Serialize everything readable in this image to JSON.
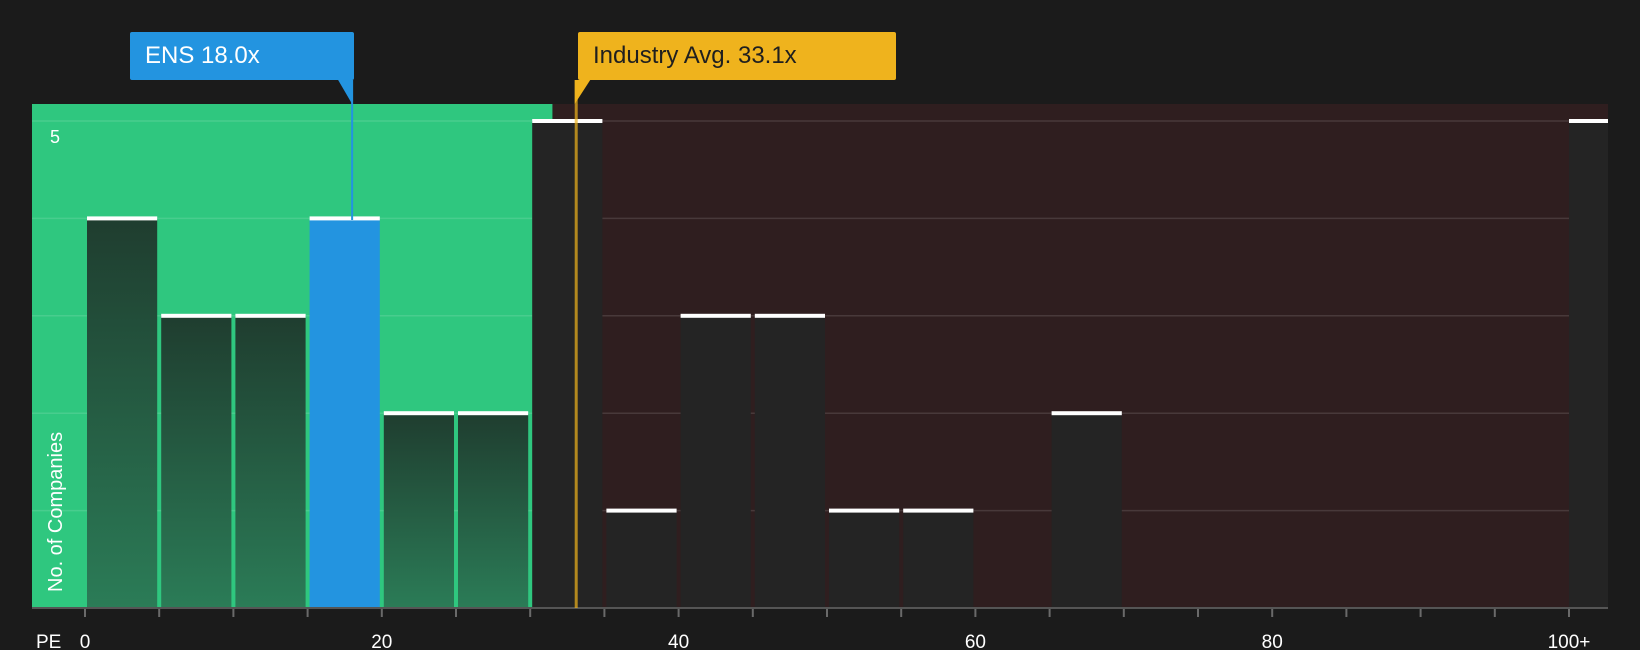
{
  "chart_data": {
    "type": "bar",
    "xlabel": "PE",
    "ylabel": "No. of Companies",
    "x_ticks": [
      "0",
      "20",
      "40",
      "60",
      "80",
      "100+"
    ],
    "y_ticks": [
      "5"
    ],
    "bin_width": 5,
    "xlim": [
      0,
      100
    ],
    "ylim": [
      0,
      5
    ],
    "bins": [
      {
        "x": 0,
        "value": 4
      },
      {
        "x": 5,
        "value": 3
      },
      {
        "x": 10,
        "value": 3
      },
      {
        "x": 15,
        "value": 4
      },
      {
        "x": 20,
        "value": 2
      },
      {
        "x": 25,
        "value": 2
      },
      {
        "x": 30,
        "value": 5
      },
      {
        "x": 35,
        "value": 1
      },
      {
        "x": 40,
        "value": 3
      },
      {
        "x": 45,
        "value": 3
      },
      {
        "x": 50,
        "value": 1
      },
      {
        "x": 55,
        "value": 1
      },
      {
        "x": 60,
        "value": 0
      },
      {
        "x": 65,
        "value": 2
      },
      {
        "x": 70,
        "value": 0
      },
      {
        "x": 75,
        "value": 0
      },
      {
        "x": 80,
        "value": 0
      },
      {
        "x": 85,
        "value": 0
      },
      {
        "x": 90,
        "value": 0
      },
      {
        "x": 95,
        "value": 0
      },
      {
        "x": 100,
        "value": 5
      }
    ],
    "company": {
      "label": "ENS 18.0x",
      "value": 18.0
    },
    "industry": {
      "label": "Industry Avg. 33.1x",
      "value": 33.1
    },
    "fair_zone_end": 31.5,
    "colors": {
      "background": "#1b1b1b",
      "green_zone": "#2fc77f",
      "red_zone": "#2f1e1f",
      "company": "#2394e0",
      "industry": "#efb31d",
      "bar_dark": "#242424",
      "cap": "#ffffff"
    }
  }
}
